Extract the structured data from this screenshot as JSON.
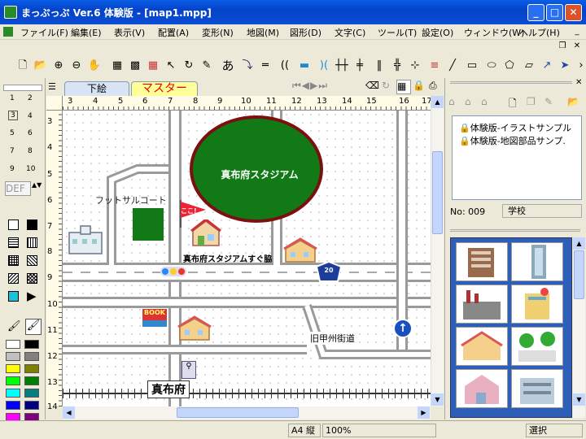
{
  "titlebar": {
    "title": "まっぷっぷ Ver.6 体験版 - [map1.mpp]",
    "minimize": "_",
    "maximize": "□",
    "close": "✕"
  },
  "menu": {
    "items": [
      "ファイル(F)",
      "編集(E)",
      "表示(V)",
      "配置(A)",
      "変形(N)",
      "地図(M)",
      "図形(D)",
      "文字(C)",
      "ツール(T)",
      "設定(O)",
      "ウィンドウ(W)",
      "ヘルプ(H)"
    ]
  },
  "toolbar": {
    "text_tool": "あ"
  },
  "tabs": {
    "shita_e": "下絵",
    "master": "マスター"
  },
  "left": {
    "line_widths": [
      "1",
      "2",
      "3",
      "4",
      "5",
      "6",
      "7",
      "8",
      "9",
      "10"
    ],
    "def": "DEF"
  },
  "ruler": {
    "top": [
      "3",
      "4",
      "5",
      "6",
      "7",
      "8",
      "9",
      "10",
      "11",
      "12",
      "13",
      "14",
      "15",
      "16",
      "17"
    ],
    "left": [
      "3",
      "4",
      "5",
      "6",
      "7",
      "8",
      "9",
      "10",
      "11",
      "12",
      "13",
      "14"
    ]
  },
  "map": {
    "stadium": "真布府スタジアム",
    "futsal": "フットサルコート",
    "shop_label": "真布府スタジアムすぐ脇",
    "street": "旧甲州街道",
    "station": "真布府",
    "route_number": "20",
    "flag_text": "ここ!",
    "book_sign": "BOOK",
    "colors": {
      "stadium_fill": "#117a17",
      "stadium_border": "#7a1010",
      "court": "#117a17"
    }
  },
  "layers": {
    "items": [
      "体験版-イラストサンプル",
      "体験版-地図部品サンプ."
    ],
    "no_label": "No: 009",
    "category": "学校"
  },
  "status": {
    "page": "A4 縦",
    "zoom": "100%",
    "mode": "選択"
  }
}
